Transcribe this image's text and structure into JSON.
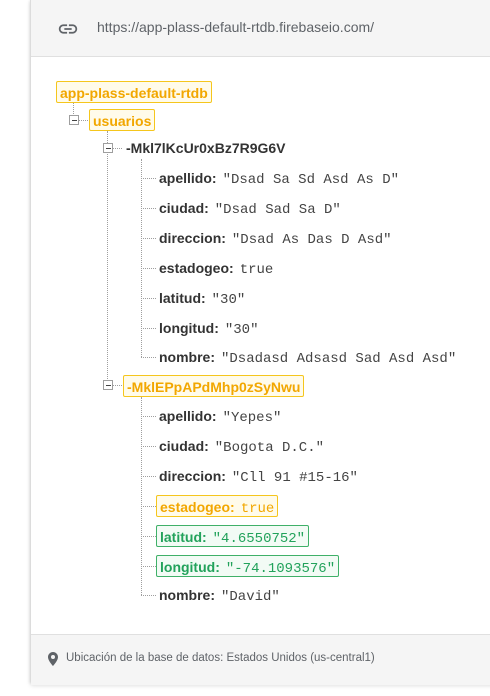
{
  "url_bar": {
    "icon": "link-icon",
    "url": "https://app-plass-default-rtdb.firebaseio.com/"
  },
  "tree": {
    "root": "app-plass-default-rtdb",
    "collection": "usuarios",
    "records": [
      {
        "id": "-Mkl7lKcUr0xBz7R9G6V",
        "fields": [
          {
            "key": "apellido:",
            "value": "\"Dsad Sa Sd Asd As D\""
          },
          {
            "key": "ciudad:",
            "value": "\"Dsad Sad Sa D\""
          },
          {
            "key": "direccion:",
            "value": "\"Dsad As Das D Asd\""
          },
          {
            "key": "estadogeo:",
            "value": "true"
          },
          {
            "key": "latitud:",
            "value": "\"30\""
          },
          {
            "key": "longitud:",
            "value": "\"30\""
          },
          {
            "key": "nombre:",
            "value": "\"Dsadasd Adsasd Sad Asd Asd\""
          }
        ]
      },
      {
        "id": "-MklEPpAPdMhp0zSyNwu",
        "fields": [
          {
            "key": "apellido:",
            "value": "\"Yepes\""
          },
          {
            "key": "ciudad:",
            "value": "\"Bogota D.C.\""
          },
          {
            "key": "direccion:",
            "value": "\"Cll 91 #15-16\""
          },
          {
            "key": "estadogeo:",
            "value": "true"
          },
          {
            "key": "latitud:",
            "value": "\"4.6550752\""
          },
          {
            "key": "longitud:",
            "value": "\"-74.1093576\""
          },
          {
            "key": "nombre:",
            "value": "\"David\""
          }
        ]
      }
    ]
  },
  "colors": {
    "highlight_changed": "#f2a700",
    "highlight_added": "#22a25b",
    "text": "#333333"
  },
  "footer": {
    "icon": "location-pin-icon",
    "text": "Ubicación de la base de datos: Estados Unidos (us-central1)"
  }
}
